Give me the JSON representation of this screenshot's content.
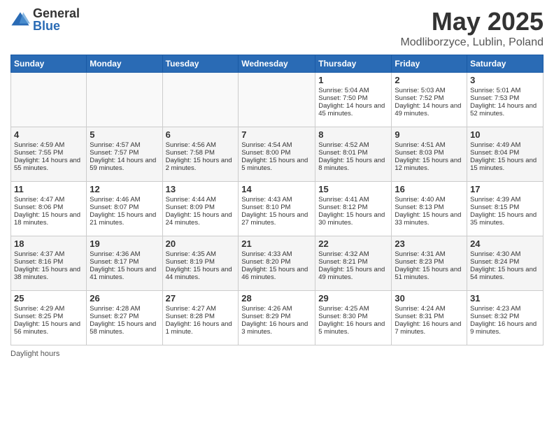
{
  "logo": {
    "general": "General",
    "blue": "Blue"
  },
  "header": {
    "month": "May 2025",
    "location": "Modliborzyce, Lublin, Poland"
  },
  "days_of_week": [
    "Sunday",
    "Monday",
    "Tuesday",
    "Wednesday",
    "Thursday",
    "Friday",
    "Saturday"
  ],
  "footer": {
    "daylight_label": "Daylight hours"
  },
  "weeks": [
    {
      "days": [
        {
          "num": "",
          "data": "",
          "empty": true
        },
        {
          "num": "",
          "data": "",
          "empty": true
        },
        {
          "num": "",
          "data": "",
          "empty": true
        },
        {
          "num": "",
          "data": "",
          "empty": true
        },
        {
          "num": "1",
          "sunrise": "Sunrise: 5:04 AM",
          "sunset": "Sunset: 7:50 PM",
          "daylight": "Daylight: 14 hours and 45 minutes.",
          "empty": false
        },
        {
          "num": "2",
          "sunrise": "Sunrise: 5:03 AM",
          "sunset": "Sunset: 7:52 PM",
          "daylight": "Daylight: 14 hours and 49 minutes.",
          "empty": false
        },
        {
          "num": "3",
          "sunrise": "Sunrise: 5:01 AM",
          "sunset": "Sunset: 7:53 PM",
          "daylight": "Daylight: 14 hours and 52 minutes.",
          "empty": false
        }
      ]
    },
    {
      "days": [
        {
          "num": "4",
          "sunrise": "Sunrise: 4:59 AM",
          "sunset": "Sunset: 7:55 PM",
          "daylight": "Daylight: 14 hours and 55 minutes.",
          "empty": false
        },
        {
          "num": "5",
          "sunrise": "Sunrise: 4:57 AM",
          "sunset": "Sunset: 7:57 PM",
          "daylight": "Daylight: 14 hours and 59 minutes.",
          "empty": false
        },
        {
          "num": "6",
          "sunrise": "Sunrise: 4:56 AM",
          "sunset": "Sunset: 7:58 PM",
          "daylight": "Daylight: 15 hours and 2 minutes.",
          "empty": false
        },
        {
          "num": "7",
          "sunrise": "Sunrise: 4:54 AM",
          "sunset": "Sunset: 8:00 PM",
          "daylight": "Daylight: 15 hours and 5 minutes.",
          "empty": false
        },
        {
          "num": "8",
          "sunrise": "Sunrise: 4:52 AM",
          "sunset": "Sunset: 8:01 PM",
          "daylight": "Daylight: 15 hours and 8 minutes.",
          "empty": false
        },
        {
          "num": "9",
          "sunrise": "Sunrise: 4:51 AM",
          "sunset": "Sunset: 8:03 PM",
          "daylight": "Daylight: 15 hours and 12 minutes.",
          "empty": false
        },
        {
          "num": "10",
          "sunrise": "Sunrise: 4:49 AM",
          "sunset": "Sunset: 8:04 PM",
          "daylight": "Daylight: 15 hours and 15 minutes.",
          "empty": false
        }
      ]
    },
    {
      "days": [
        {
          "num": "11",
          "sunrise": "Sunrise: 4:47 AM",
          "sunset": "Sunset: 8:06 PM",
          "daylight": "Daylight: 15 hours and 18 minutes.",
          "empty": false
        },
        {
          "num": "12",
          "sunrise": "Sunrise: 4:46 AM",
          "sunset": "Sunset: 8:07 PM",
          "daylight": "Daylight: 15 hours and 21 minutes.",
          "empty": false
        },
        {
          "num": "13",
          "sunrise": "Sunrise: 4:44 AM",
          "sunset": "Sunset: 8:09 PM",
          "daylight": "Daylight: 15 hours and 24 minutes.",
          "empty": false
        },
        {
          "num": "14",
          "sunrise": "Sunrise: 4:43 AM",
          "sunset": "Sunset: 8:10 PM",
          "daylight": "Daylight: 15 hours and 27 minutes.",
          "empty": false
        },
        {
          "num": "15",
          "sunrise": "Sunrise: 4:41 AM",
          "sunset": "Sunset: 8:12 PM",
          "daylight": "Daylight: 15 hours and 30 minutes.",
          "empty": false
        },
        {
          "num": "16",
          "sunrise": "Sunrise: 4:40 AM",
          "sunset": "Sunset: 8:13 PM",
          "daylight": "Daylight: 15 hours and 33 minutes.",
          "empty": false
        },
        {
          "num": "17",
          "sunrise": "Sunrise: 4:39 AM",
          "sunset": "Sunset: 8:15 PM",
          "daylight": "Daylight: 15 hours and 35 minutes.",
          "empty": false
        }
      ]
    },
    {
      "days": [
        {
          "num": "18",
          "sunrise": "Sunrise: 4:37 AM",
          "sunset": "Sunset: 8:16 PM",
          "daylight": "Daylight: 15 hours and 38 minutes.",
          "empty": false
        },
        {
          "num": "19",
          "sunrise": "Sunrise: 4:36 AM",
          "sunset": "Sunset: 8:17 PM",
          "daylight": "Daylight: 15 hours and 41 minutes.",
          "empty": false
        },
        {
          "num": "20",
          "sunrise": "Sunrise: 4:35 AM",
          "sunset": "Sunset: 8:19 PM",
          "daylight": "Daylight: 15 hours and 44 minutes.",
          "empty": false
        },
        {
          "num": "21",
          "sunrise": "Sunrise: 4:33 AM",
          "sunset": "Sunset: 8:20 PM",
          "daylight": "Daylight: 15 hours and 46 minutes.",
          "empty": false
        },
        {
          "num": "22",
          "sunrise": "Sunrise: 4:32 AM",
          "sunset": "Sunset: 8:21 PM",
          "daylight": "Daylight: 15 hours and 49 minutes.",
          "empty": false
        },
        {
          "num": "23",
          "sunrise": "Sunrise: 4:31 AM",
          "sunset": "Sunset: 8:23 PM",
          "daylight": "Daylight: 15 hours and 51 minutes.",
          "empty": false
        },
        {
          "num": "24",
          "sunrise": "Sunrise: 4:30 AM",
          "sunset": "Sunset: 8:24 PM",
          "daylight": "Daylight: 15 hours and 54 minutes.",
          "empty": false
        }
      ]
    },
    {
      "days": [
        {
          "num": "25",
          "sunrise": "Sunrise: 4:29 AM",
          "sunset": "Sunset: 8:25 PM",
          "daylight": "Daylight: 15 hours and 56 minutes.",
          "empty": false
        },
        {
          "num": "26",
          "sunrise": "Sunrise: 4:28 AM",
          "sunset": "Sunset: 8:27 PM",
          "daylight": "Daylight: 15 hours and 58 minutes.",
          "empty": false
        },
        {
          "num": "27",
          "sunrise": "Sunrise: 4:27 AM",
          "sunset": "Sunset: 8:28 PM",
          "daylight": "Daylight: 16 hours and 1 minute.",
          "empty": false
        },
        {
          "num": "28",
          "sunrise": "Sunrise: 4:26 AM",
          "sunset": "Sunset: 8:29 PM",
          "daylight": "Daylight: 16 hours and 3 minutes.",
          "empty": false
        },
        {
          "num": "29",
          "sunrise": "Sunrise: 4:25 AM",
          "sunset": "Sunset: 8:30 PM",
          "daylight": "Daylight: 16 hours and 5 minutes.",
          "empty": false
        },
        {
          "num": "30",
          "sunrise": "Sunrise: 4:24 AM",
          "sunset": "Sunset: 8:31 PM",
          "daylight": "Daylight: 16 hours and 7 minutes.",
          "empty": false
        },
        {
          "num": "31",
          "sunrise": "Sunrise: 4:23 AM",
          "sunset": "Sunset: 8:32 PM",
          "daylight": "Daylight: 16 hours and 9 minutes.",
          "empty": false
        }
      ]
    }
  ]
}
